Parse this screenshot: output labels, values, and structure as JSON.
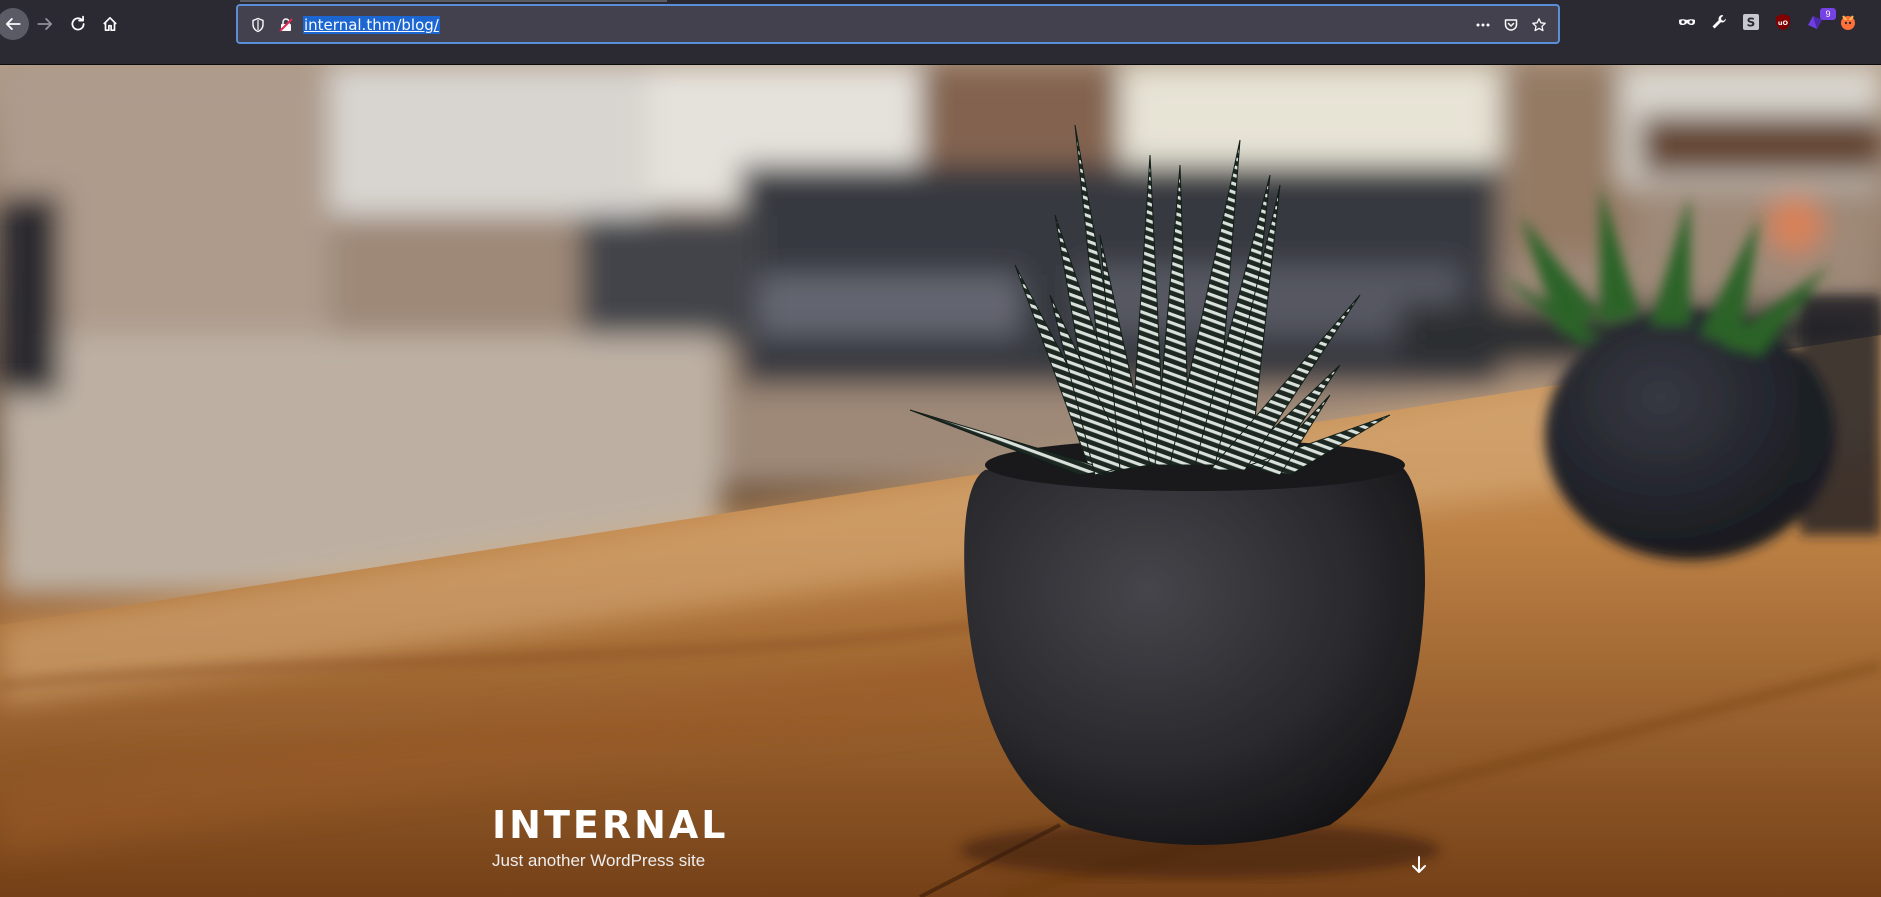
{
  "browser": {
    "url": "internal.thm/blog/",
    "toolbar_icons": [
      "back-arrow-icon",
      "forward-arrow-icon",
      "reload-icon",
      "home-icon"
    ],
    "urlbar_icons": [
      "shield-icon",
      "insecure-lock-icon",
      "more-dots-icon",
      "pocket-icon",
      "bookmark-star-icon"
    ],
    "extensions": [
      "mask-icon",
      "wrench-icon",
      "s-extension-icon",
      "ublock-icon",
      "extension-purple-icon",
      "fox-extension-icon"
    ],
    "extension_badge": "9",
    "colors": {
      "toolbar": "#2b2a33",
      "urlbar": "#42414d",
      "focus": "#5a8fd8",
      "selection": "#1b66d1"
    }
  },
  "site": {
    "title": "INTERNAL",
    "tagline": "Just another WordPress site",
    "scroll_icon": "arrow-down-icon"
  }
}
